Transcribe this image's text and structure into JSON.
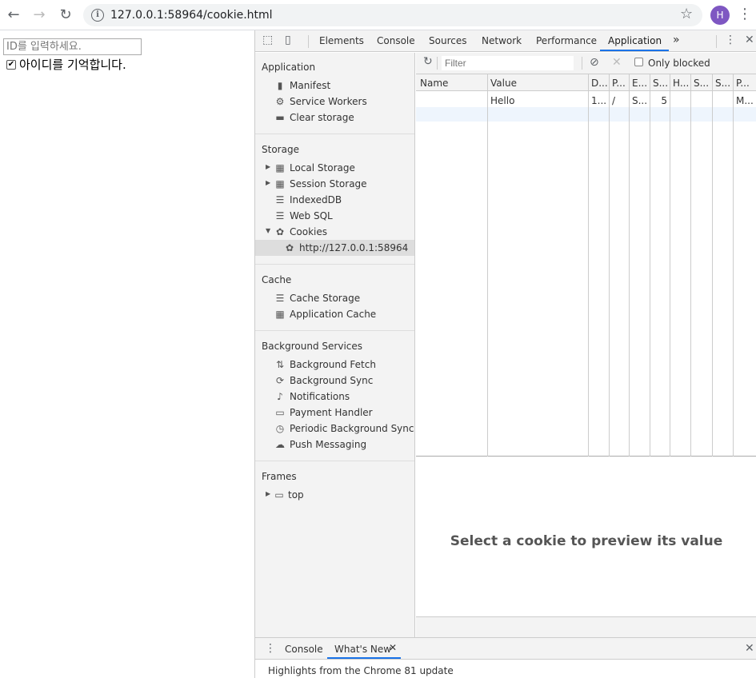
{
  "browser": {
    "url": "127.0.0.1:58964/cookie.html",
    "avatar_initial": "H"
  },
  "page": {
    "id_placeholder": "ID를 입력하세요.",
    "remember_label": "아이디를 기억합니다.",
    "remember_checked": true
  },
  "devtools": {
    "tabs": [
      "Elements",
      "Console",
      "Sources",
      "Network",
      "Performance",
      "Application"
    ],
    "more_tabs": "»",
    "sidebar": {
      "application_header": "Application",
      "application_items": [
        "Manifest",
        "Service Workers",
        "Clear storage"
      ],
      "storage_header": "Storage",
      "storage_items": [
        "Local Storage",
        "Session Storage",
        "IndexedDB",
        "Web SQL",
        "Cookies"
      ],
      "cookie_origin": "http://127.0.0.1:58964",
      "cache_header": "Cache",
      "cache_items": [
        "Cache Storage",
        "Application Cache"
      ],
      "bg_header": "Background Services",
      "bg_items": [
        "Background Fetch",
        "Background Sync",
        "Notifications",
        "Payment Handler",
        "Periodic Background Sync",
        "Push Messaging"
      ],
      "frames_header": "Frames",
      "frames_items": [
        "top"
      ]
    },
    "filter": {
      "placeholder": "Filter",
      "only_blocked": "Only blocked"
    },
    "table": {
      "headers": [
        "Name",
        "Value",
        "D...",
        "P...",
        "E...",
        "S...",
        "H...",
        "S...",
        "S...",
        "P..."
      ],
      "row": [
        "",
        "Hello",
        "1...",
        "/",
        "S...",
        "5",
        "",
        "",
        "",
        "M..."
      ]
    },
    "preview_text": "Select a cookie to preview its value",
    "drawer": {
      "tabs": [
        "Console",
        "What's New"
      ],
      "highlights": "Highlights from the Chrome 81 update"
    }
  }
}
